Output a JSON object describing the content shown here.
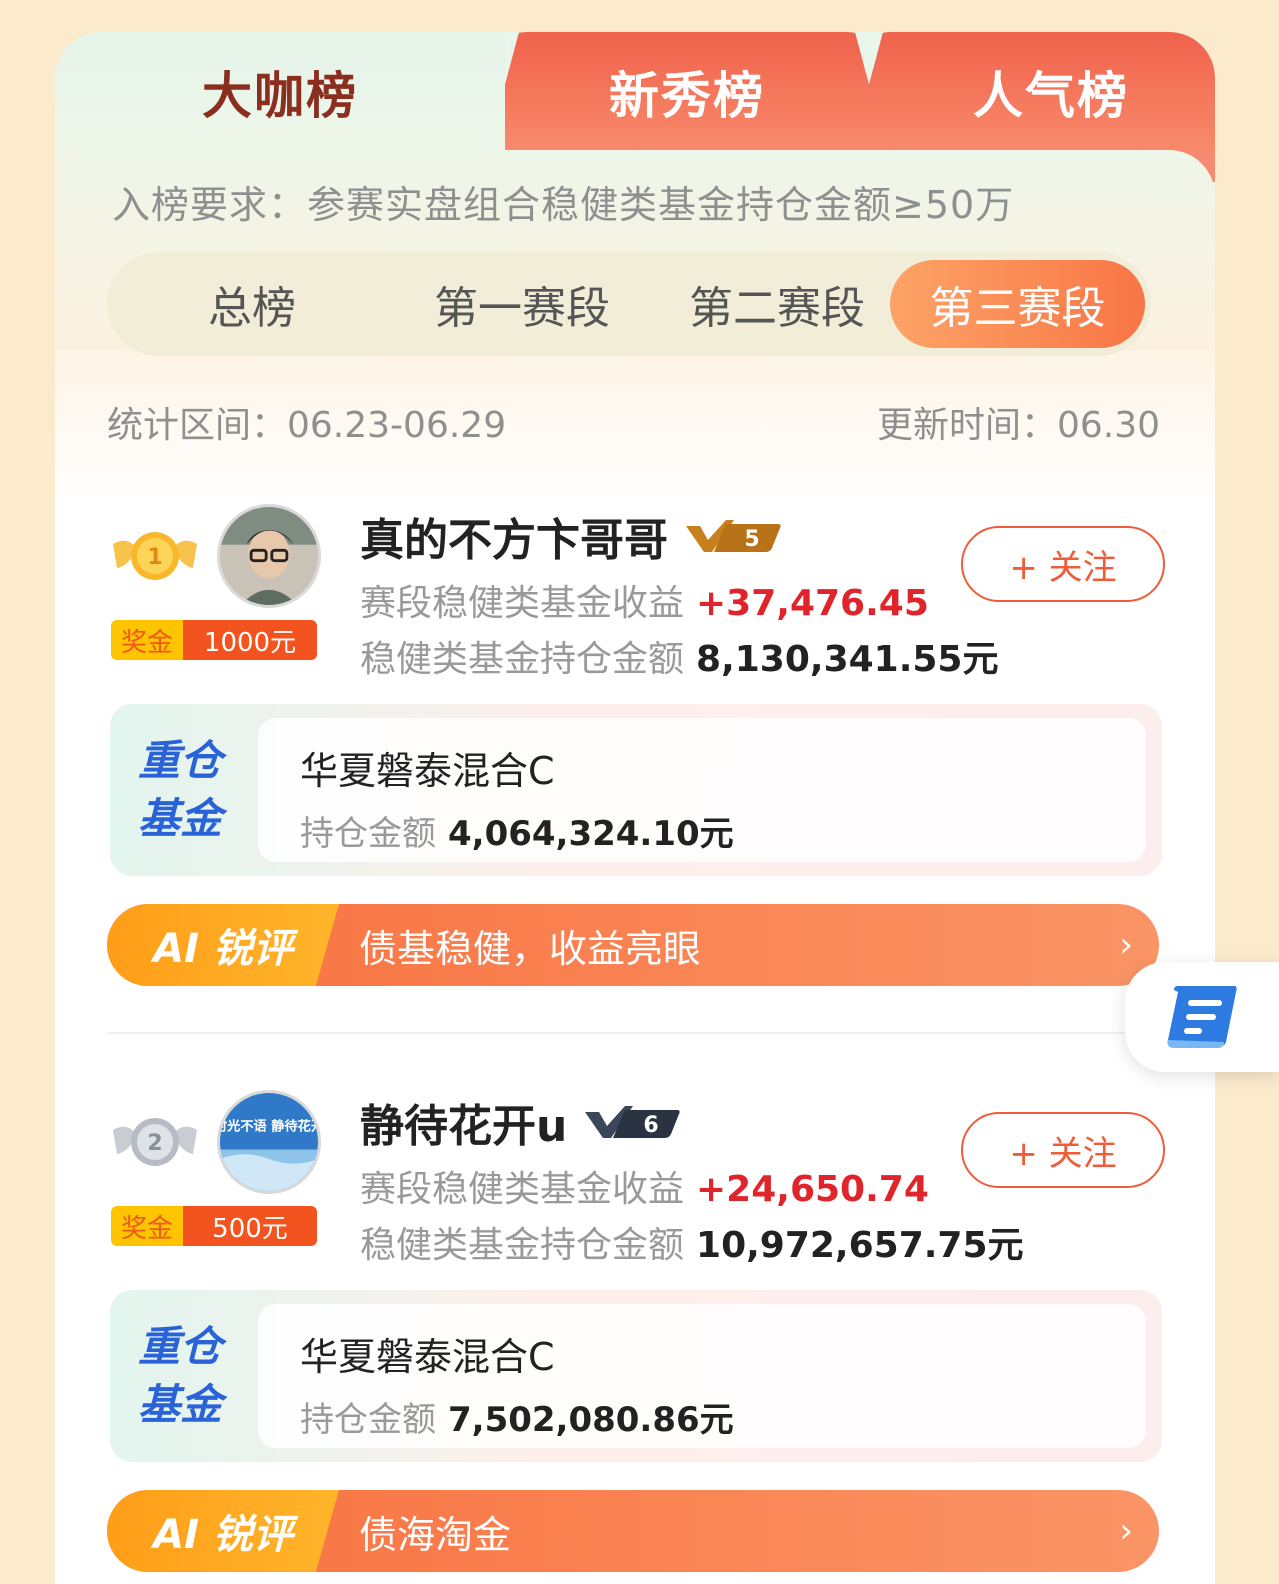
{
  "tabs": [
    {
      "label": "大咖榜",
      "active": true
    },
    {
      "label": "新秀榜",
      "active": false
    },
    {
      "label": "人气榜",
      "active": false
    }
  ],
  "requirement": "入榜要求：参赛实盘组合稳健类基金持仓金额≥50万",
  "segments": [
    {
      "label": "总榜",
      "active": false
    },
    {
      "label": "第一赛段",
      "active": false
    },
    {
      "label": "第二赛段",
      "active": false
    },
    {
      "label": "第三赛段",
      "active": true
    }
  ],
  "stats": {
    "period": "统计区间：06.23-06.29",
    "updated": "更新时间：06.30"
  },
  "entries": [
    {
      "rank": "1",
      "prize_label": "奖金",
      "prize_amount": "1000元",
      "name": "真的不方卞哥哥",
      "level": "5",
      "return_label": "赛段稳健类基金收益",
      "return_value": "+37,476.45",
      "holding_label": "稳健类基金持仓金额",
      "holding_value": "8,130,341.55元",
      "follow_label": "+ 关注",
      "fund_tag": "重仓基金",
      "fund_name": "华夏磐泰混合C",
      "fund_amount_label": "持仓金额",
      "fund_amount": "4,064,324.10元",
      "ai_label": "AI 锐评",
      "ai_text": "债基稳健，收益亮眼"
    },
    {
      "rank": "2",
      "prize_label": "奖金",
      "prize_amount": "500元",
      "name": "静待花开u",
      "level": "6",
      "avatar_text": "时光不语 静待花开",
      "return_label": "赛段稳健类基金收益",
      "return_value": "+24,650.74",
      "holding_label": "稳健类基金持仓金额",
      "holding_value": "10,972,657.75元",
      "follow_label": "+ 关注",
      "fund_tag": "重仓基金",
      "fund_name": "华夏磐泰混合C",
      "fund_amount_label": "持仓金额",
      "fund_amount": "7,502,080.86元",
      "ai_label": "AI 锐评",
      "ai_text": "债海淘金"
    }
  ],
  "colors": {
    "accent": "#f05c3a",
    "positive": "#e0242b",
    "fund_tag": "#2a63d8",
    "background": "#fbeacb"
  }
}
